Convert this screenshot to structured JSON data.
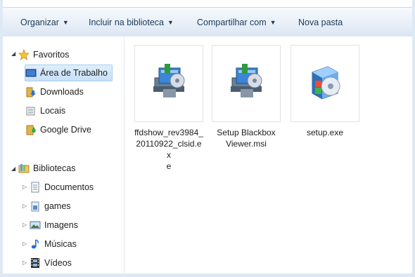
{
  "toolbar": {
    "organize": "Organizar",
    "include": "Incluir na biblioteca",
    "share": "Compartilhar com",
    "new_folder": "Nova pasta"
  },
  "nav": {
    "favorites": {
      "label": "Favoritos",
      "items": [
        {
          "label": "Área de Trabalho",
          "icon": "desktop-icon"
        },
        {
          "label": "Downloads",
          "icon": "downloads-folder-icon"
        },
        {
          "label": "Locais",
          "icon": "recent-places-icon"
        },
        {
          "label": "Google Drive",
          "icon": "google-drive-folder-icon"
        }
      ]
    },
    "libraries": {
      "label": "Bibliotecas",
      "items": [
        {
          "label": "Documentos",
          "icon": "documents-library-icon"
        },
        {
          "label": "games",
          "icon": "library-icon"
        },
        {
          "label": "Imagens",
          "icon": "pictures-library-icon"
        },
        {
          "label": "Músicas",
          "icon": "music-library-icon"
        },
        {
          "label": "Vídeos",
          "icon": "videos-library-icon"
        }
      ]
    }
  },
  "files": [
    {
      "name_lines": [
        "ffdshow_rev3984_",
        "20110922_clsid.ex",
        "e"
      ],
      "icon": "installer-icon"
    },
    {
      "name_lines": [
        "Setup Blackbox",
        "Viewer.msi"
      ],
      "icon": "installer-icon"
    },
    {
      "name_lines": [
        "setup.exe"
      ],
      "icon": "setup-exe-icon"
    }
  ],
  "colors": {
    "toolbar_text": "#1e395b",
    "selection": "#c8e0f7",
    "frame": "#dfe9f5"
  }
}
